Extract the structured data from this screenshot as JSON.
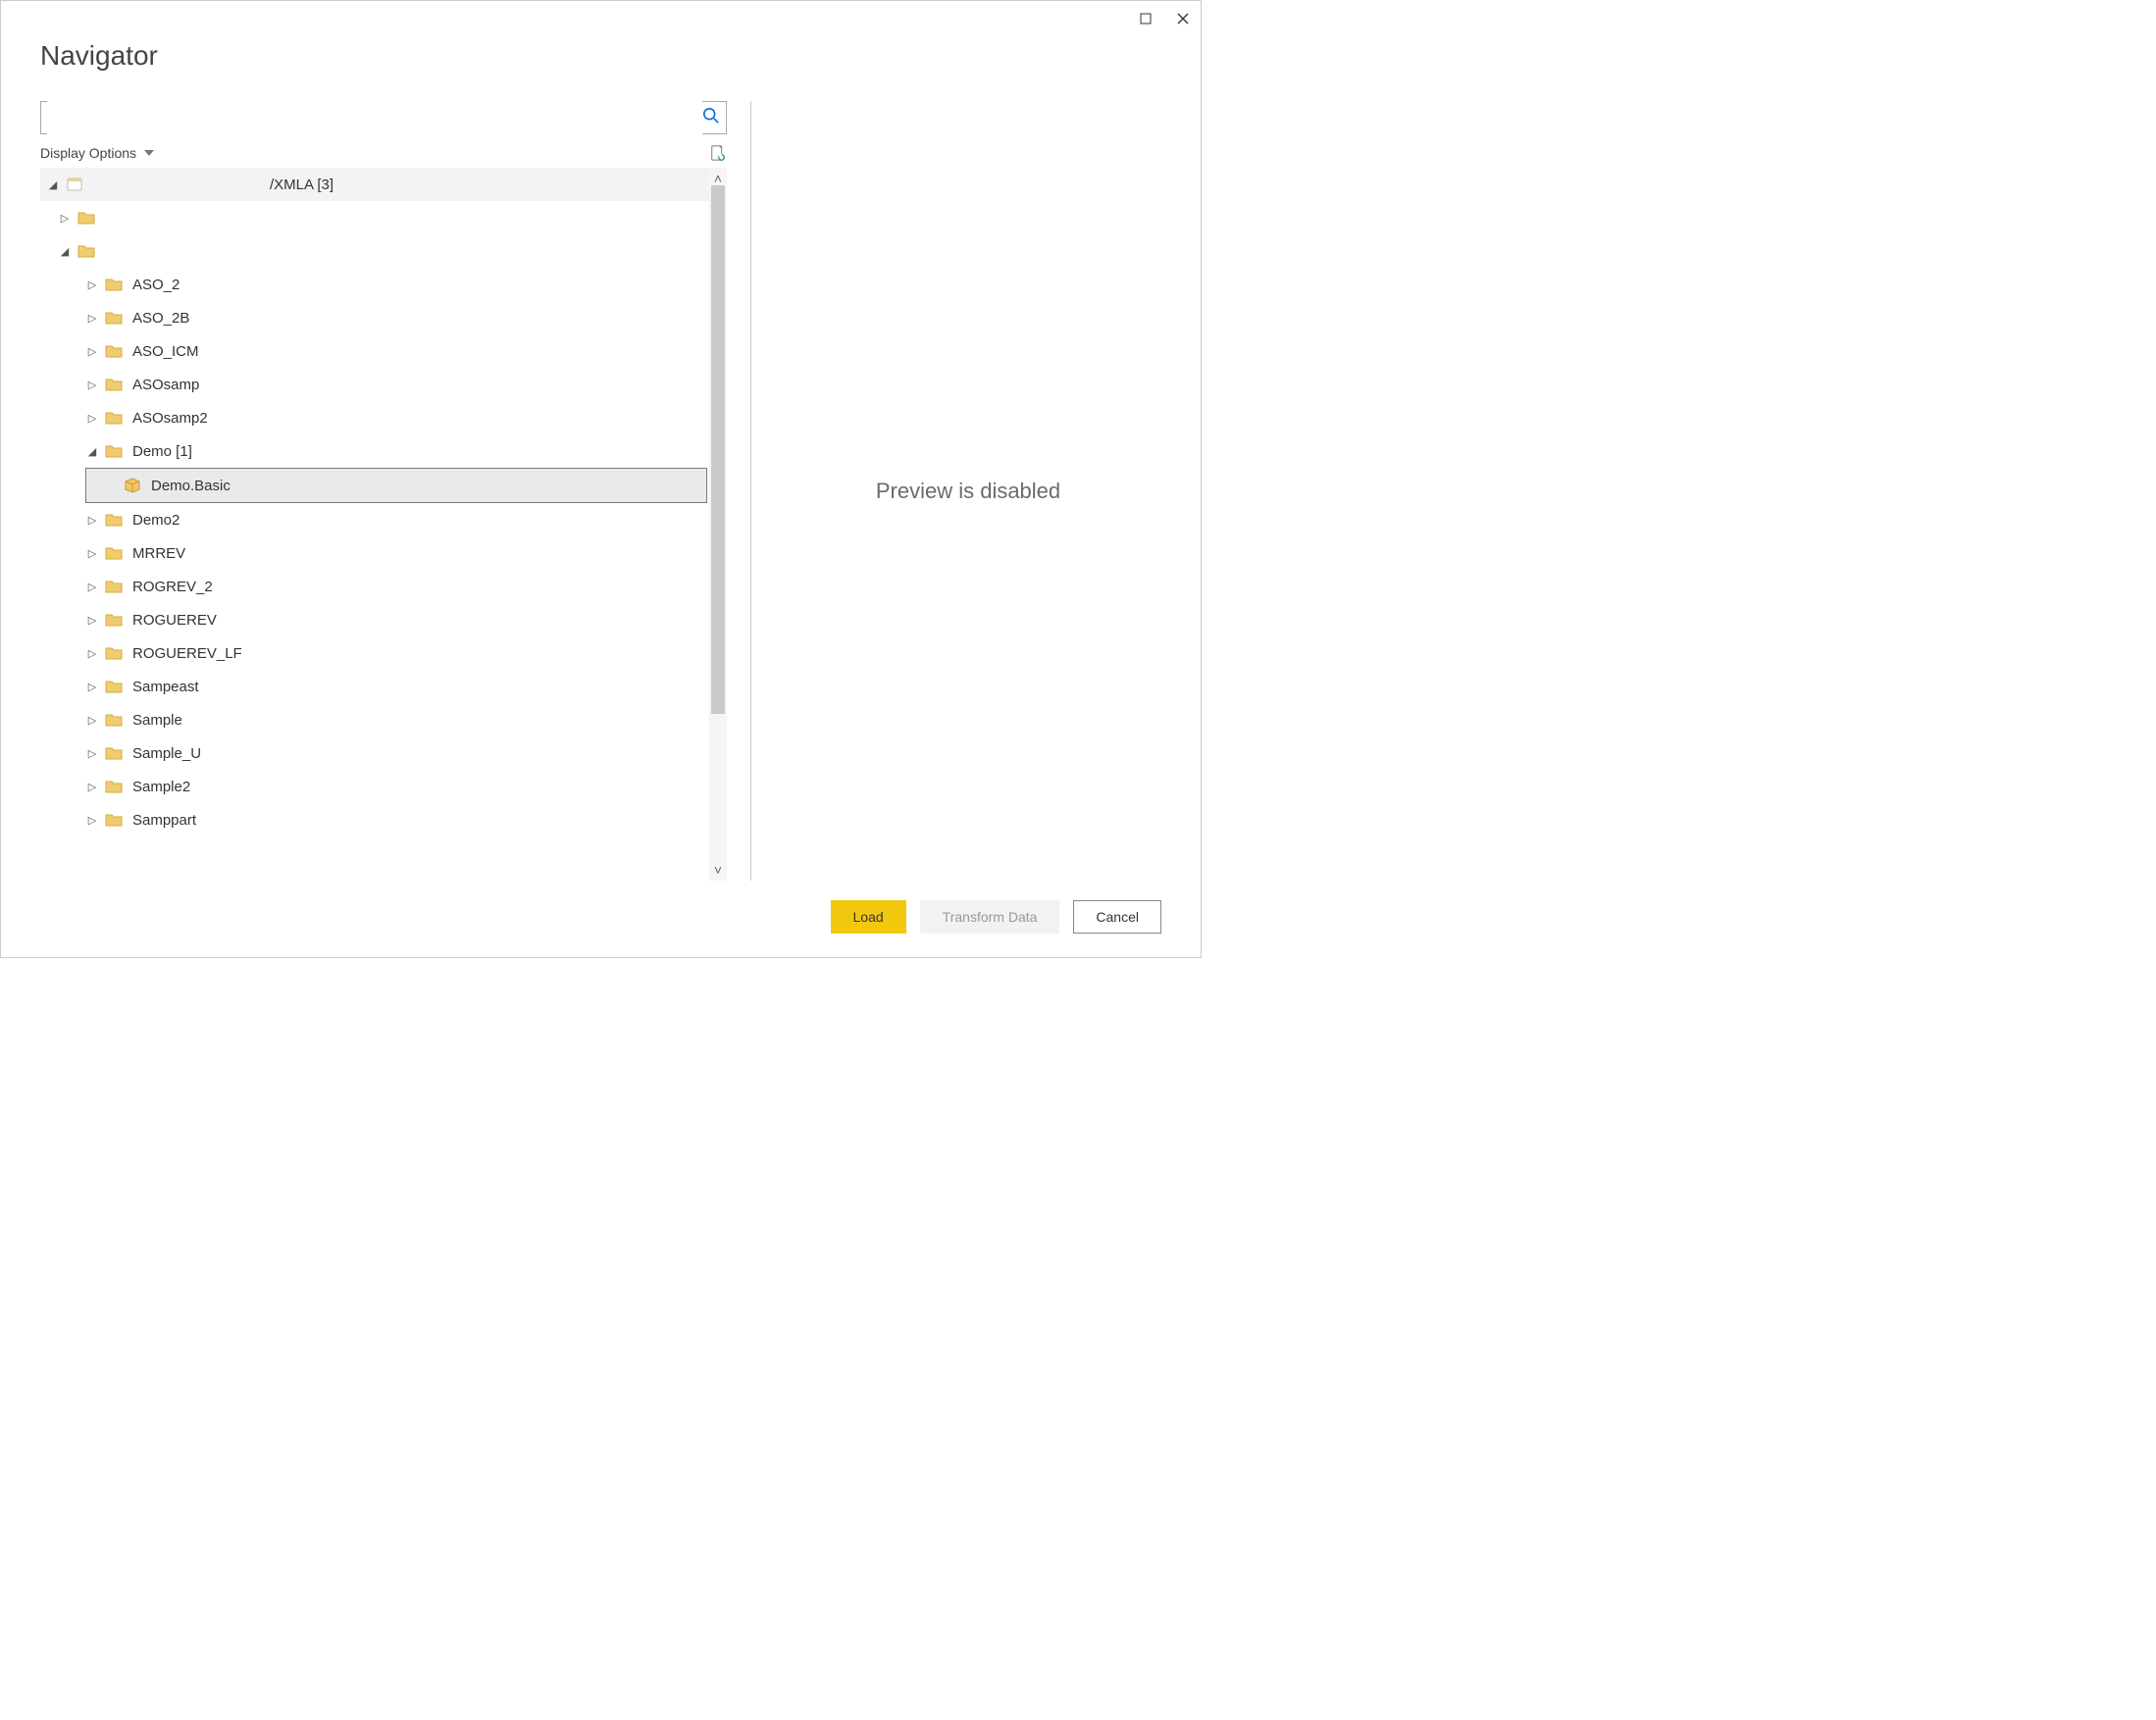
{
  "window": {
    "title": "Navigator"
  },
  "search": {
    "value": "",
    "placeholder": ""
  },
  "options": {
    "label": "Display Options"
  },
  "tree": {
    "root": {
      "label": "/XMLA [3]",
      "expanded": true
    },
    "level1": [
      {
        "label": "",
        "expanded": false,
        "expander": "▷"
      },
      {
        "label": "",
        "expanded": true,
        "expander": "◢"
      }
    ],
    "folders": [
      {
        "label": "ASO_2",
        "expander": "▷"
      },
      {
        "label": "ASO_2B",
        "expander": "▷"
      },
      {
        "label": "ASO_ICM",
        "expander": "▷"
      },
      {
        "label": "ASOsamp",
        "expander": "▷"
      },
      {
        "label": "ASOsamp2",
        "expander": "▷"
      },
      {
        "label": "Demo [1]",
        "expander": "◢",
        "expanded": true
      },
      {
        "label": "Demo2",
        "expander": "▷"
      },
      {
        "label": "MRREV",
        "expander": "▷"
      },
      {
        "label": "ROGREV_2",
        "expander": "▷"
      },
      {
        "label": "ROGUEREV",
        "expander": "▷"
      },
      {
        "label": "ROGUEREV_LF",
        "expander": "▷"
      },
      {
        "label": "Sampeast",
        "expander": "▷"
      },
      {
        "label": "Sample",
        "expander": "▷"
      },
      {
        "label": "Sample_U",
        "expander": "▷"
      },
      {
        "label": "Sample2",
        "expander": "▷"
      },
      {
        "label": "Samppart",
        "expander": "▷"
      }
    ],
    "selected_leaf": {
      "label": "Demo.Basic"
    }
  },
  "preview": {
    "message": "Preview is disabled"
  },
  "buttons": {
    "load": "Load",
    "transform": "Transform Data",
    "cancel": "Cancel"
  }
}
